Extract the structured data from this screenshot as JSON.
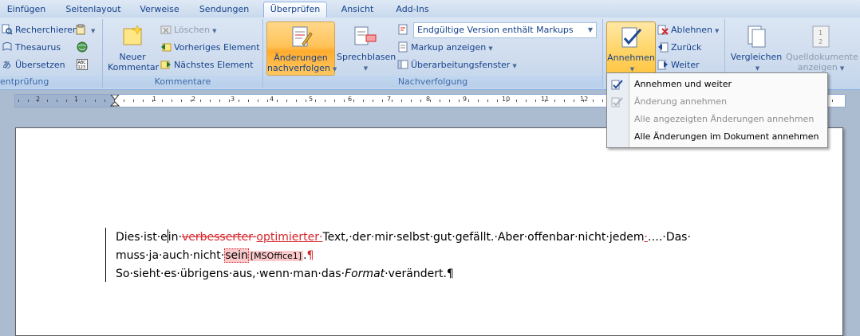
{
  "tabs": [
    {
      "label": "Einfügen"
    },
    {
      "label": "Seitenlayout"
    },
    {
      "label": "Verweise"
    },
    {
      "label": "Sendungen"
    },
    {
      "label": "Überprüfen"
    },
    {
      "label": "Ansicht"
    },
    {
      "label": "Add-Ins"
    }
  ],
  "groups": {
    "proofing": {
      "label": "entprüfung",
      "research": "Recherchieren",
      "thesaurus": "Thesaurus",
      "translate": "Übersetzen"
    },
    "comments": {
      "label": "Kommentare",
      "new_line1": "Neuer",
      "new_line2": "Kommentar",
      "delete": "Löschen",
      "previous": "Vorheriges Element",
      "next": "Nächstes Element"
    },
    "tracking": {
      "label": "Nachverfolgung",
      "track_line1": "Änderungen",
      "track_line2": "nachverfolgen",
      "balloons": "Sprechblasen",
      "display_mode": "Endgültige Version enthält Markups",
      "show_markup": "Markup anzeigen",
      "reviewing_pane": "Überarbeitungsfenster"
    },
    "changes": {
      "accept": "Annehmen",
      "reject": "Ablehnen",
      "previous": "Zurück",
      "next": "Weiter"
    },
    "compare": {
      "compare": "Vergleichen",
      "source_line1": "Quelldokumente",
      "source_line2": "anzeigen"
    }
  },
  "ruler": {
    "numbers": [
      "2",
      "1",
      "1",
      "2",
      "3",
      "4",
      "5",
      "6",
      "7",
      "8",
      "9",
      "10",
      "11",
      "12"
    ]
  },
  "accept_menu": {
    "items": [
      {
        "label": "Annehmen und weiter",
        "enabled": true
      },
      {
        "label": "Änderung annehmen",
        "enabled": false
      },
      {
        "label": "Alle angezeigten Änderungen annehmen",
        "enabled": false
      },
      {
        "label": "Alle Änderungen im Dokument annehmen",
        "enabled": true
      }
    ]
  },
  "document": {
    "line1": {
      "a": "Dies·ist·e",
      "b": "in·",
      "deleted": "verbesserter·",
      "inserted": "optimierter·",
      "c": "Text,·der·mir·selbst·gut·gefällt.·Aber·offenbar·nicht·jedem",
      "inserted2": "·",
      "d": "….·Das·"
    },
    "line2": {
      "a": "muss·ja·auch·nicht·",
      "commented": "sein",
      "comment_tag": "[MSOffice1]",
      "b": ".",
      "pilcrow": "¶"
    },
    "line3": {
      "a": "So·sieht·es·übrigens·aus,·wenn·man·das·",
      "italic": "Format",
      "b": "·verändert.",
      "pilcrow": "¶"
    }
  },
  "colors": {
    "revision": "#d7242a",
    "ribbon_text": "#15428b",
    "hot_button": "#ffc35a"
  }
}
